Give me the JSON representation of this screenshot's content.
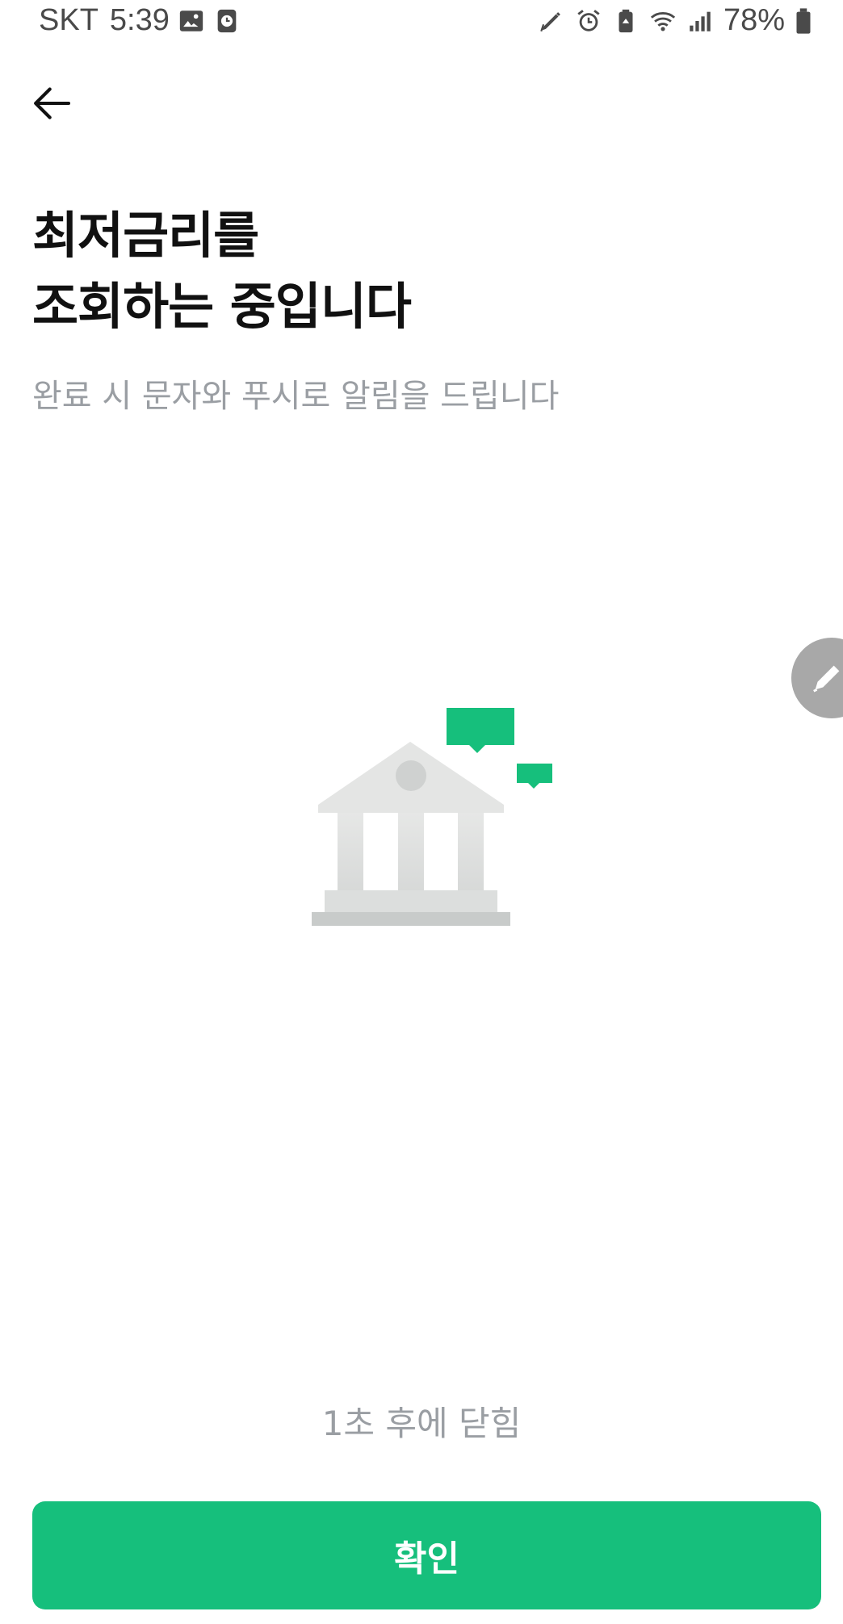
{
  "status_bar": {
    "carrier": "SKT",
    "time": "5:39",
    "battery": "78%",
    "icons": [
      "gallery-icon",
      "clock-app-icon",
      "pen-icon",
      "alarm-icon",
      "battery-saver-icon",
      "wifi-icon",
      "signal-icon",
      "battery-icon"
    ]
  },
  "header": {
    "back_icon": "arrow-left-icon"
  },
  "main": {
    "title_line1": "최저금리를",
    "title_line2": "조회하는 중입니다",
    "subtitle": "완료 시 문자와 푸시로 알림을 드립니다",
    "illustration": "bank-building-with-chat-bubbles",
    "auto_close_text": "1초 후에 닫힘"
  },
  "floating_button": {
    "icon": "pencil-icon"
  },
  "footer": {
    "confirm_label": "확인"
  },
  "colors": {
    "accent": "#16bf7c",
    "title": "#111111",
    "muted_text": "#9a9ea3",
    "illustration_gray": "#dcdedd",
    "fab_gray": "#a8a8a8"
  }
}
